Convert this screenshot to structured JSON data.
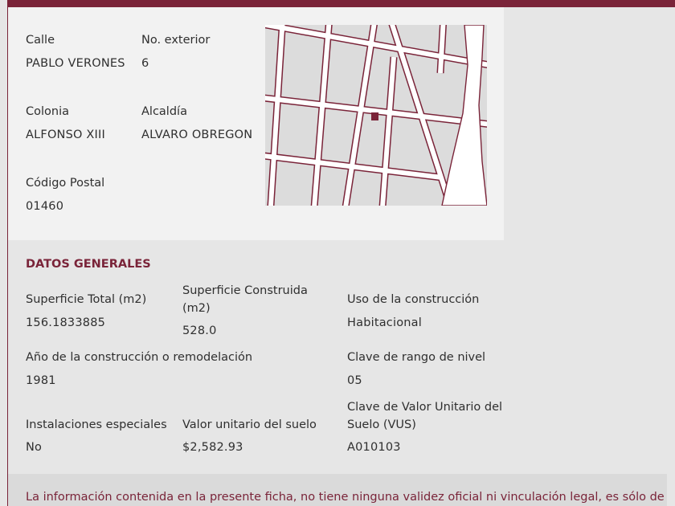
{
  "address": {
    "calle": {
      "label": "Calle",
      "value": "PABLO VERONES"
    },
    "no_exterior": {
      "label": "No. exterior",
      "value": "6"
    },
    "colonia": {
      "label": "Colonia",
      "value": "ALFONSO XIII"
    },
    "alcaldia": {
      "label": "Alcaldía",
      "value": "ALVARO OBREGON"
    },
    "codigo_postal": {
      "label": "Código Postal",
      "value": "01460"
    }
  },
  "map": {
    "road_color": "#7a2439",
    "block_color": "#dcdcdc",
    "marker_color": "#7a2439"
  },
  "general": {
    "title": "DATOS GENERALES",
    "superficie_total": {
      "label": "Superficie Total (m2)",
      "value": "156.1833885"
    },
    "superficie_construida": {
      "label_line1": "Superficie Construida",
      "label_line2": "(m2)",
      "value": "528.0"
    },
    "uso_construccion": {
      "label": "Uso de la construcción",
      "value": "Habitacional"
    },
    "anio_construccion": {
      "label": "Año de la construcción o remodelación",
      "value": "1981"
    },
    "clave_rango_nivel": {
      "label": "Clave de rango de nivel",
      "value": "05"
    },
    "instalaciones_especiales": {
      "label": "Instalaciones especiales",
      "value": "No"
    },
    "valor_unitario_suelo": {
      "label": "Valor unitario del suelo",
      "value": "$2,582.93"
    },
    "clave_vus": {
      "label_line1": "Clave de Valor Unitario del",
      "label_line2": "Suelo (VUS)",
      "value": "A010103"
    }
  },
  "disclaimer": "La información contenida en la presente ficha, no tiene ninguna validez oficial ni vinculación legal, es sólo de"
}
